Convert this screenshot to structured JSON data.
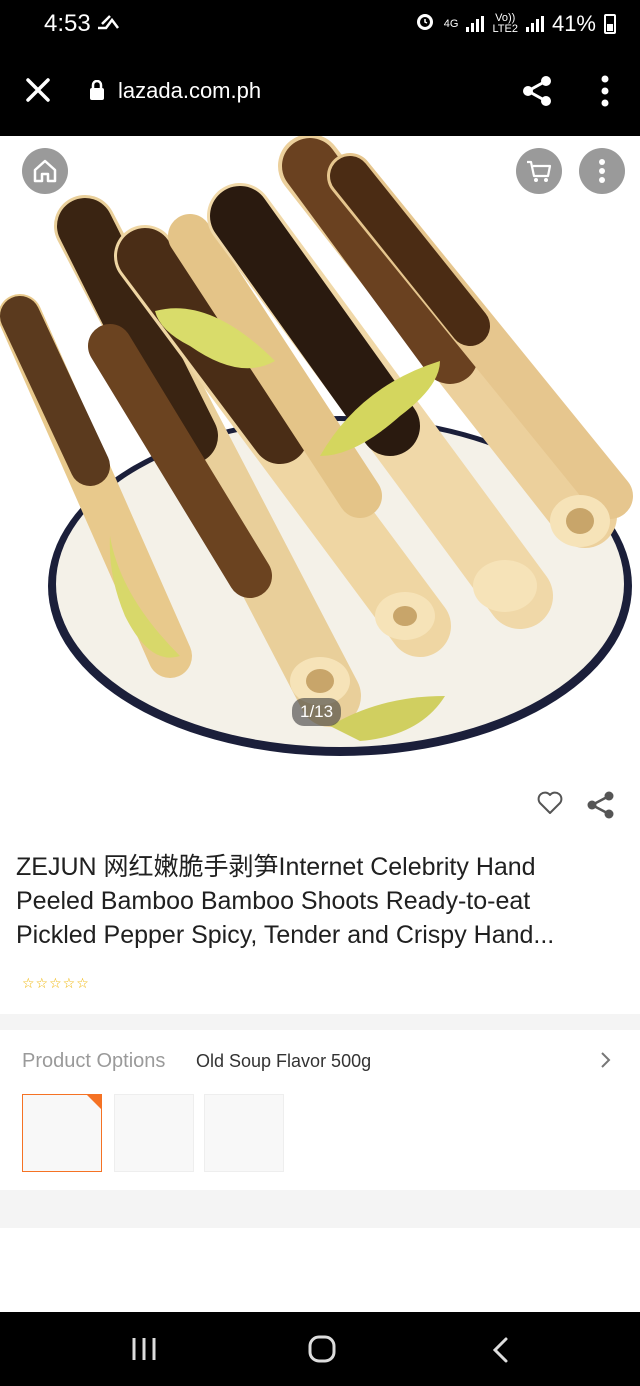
{
  "status_bar": {
    "time": "4:53",
    "network_top": "4G",
    "volte_top": "Vo))",
    "volte_bottom": "LTE2",
    "battery": "41%"
  },
  "browser": {
    "url": "lazada.com.ph"
  },
  "gallery": {
    "counter": "1/13"
  },
  "product": {
    "title": "ZEJUN 网红嫩脆手剥笋Internet Celebrity Hand Peeled Bamboo Bamboo Shoots Ready-to-eat Pickled Pepper Spicy, Tender and Crispy Hand...",
    "rating_stars": "☆☆☆☆☆"
  },
  "options": {
    "label": "Product Options",
    "selected_value": "Old Soup Flavor 500g"
  },
  "colors": {
    "accent": "#f57224",
    "star": "#f0b400"
  },
  "icons": [
    "close-icon",
    "lock-icon",
    "share-icon",
    "more-vertical-icon",
    "home-icon",
    "cart-icon",
    "heart-icon",
    "recent-apps-icon",
    "home-nav-icon",
    "back-icon"
  ]
}
